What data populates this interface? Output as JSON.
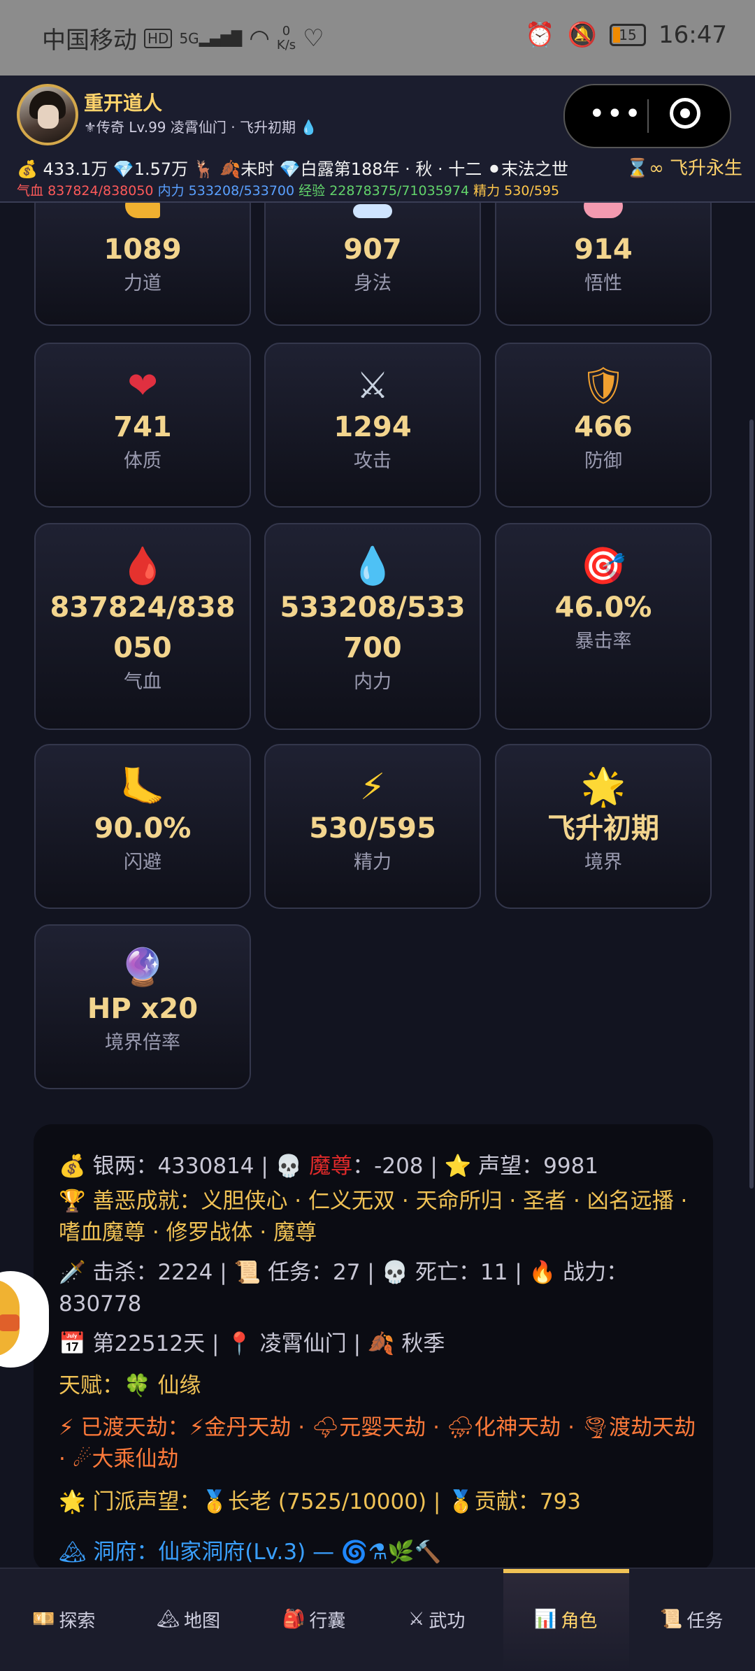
{
  "status_bar": {
    "carrier": "中国移动",
    "hd": "HD",
    "network": "5G",
    "speed_value": "0",
    "speed_unit": "K/s",
    "battery": "15",
    "time": "16:47"
  },
  "header": {
    "name": "重开道人",
    "subtitle": "⚜传奇 Lv.99 凌霄仙门 · 飞升初期 💧",
    "line1": "💰 433.1万 💎1.57万 🦌 🍂未时 💎白露第188年 · 秋 · 十二 ⚫末法之世",
    "ascend": "⌛∞ 飞升永生",
    "hp_label": "气血",
    "hp_value": "837824/838050",
    "mp_label": "内力",
    "mp_value": "533208/533700",
    "exp_label": "经验",
    "exp_value": "22878375/71035974",
    "en_label": "精力",
    "en_value": "530/595"
  },
  "stats": [
    {
      "value": "1089",
      "label": "力道",
      "icon": "muscle-icon"
    },
    {
      "value": "907",
      "label": "身法",
      "icon": "wind-icon"
    },
    {
      "value": "914",
      "label": "悟性",
      "icon": "brain-icon"
    },
    {
      "value": "741",
      "label": "体质",
      "glyph": "❤",
      "icon": "heart-icon"
    },
    {
      "value": "1294",
      "label": "攻击",
      "glyph": "⚔",
      "icon": "swords-icon"
    },
    {
      "value": "466",
      "label": "防御",
      "glyph": "🛡",
      "icon": "shield-icon"
    },
    {
      "value": "837824/838050",
      "label": "气血",
      "glyph": "🩸",
      "icon": "blood-drop-icon"
    },
    {
      "value": "533208/533700",
      "label": "内力",
      "glyph": "💧",
      "icon": "water-drop-icon"
    },
    {
      "value": "46.0%",
      "label": "暴击率",
      "glyph": "🎯",
      "icon": "target-icon"
    },
    {
      "value": "90.0%",
      "label": "闪避",
      "glyph": "🦶",
      "icon": "foot-icon"
    },
    {
      "value": "530/595",
      "label": "精力",
      "glyph": "⚡",
      "icon": "lightning-icon"
    },
    {
      "value": "飞升初期",
      "label": "境界",
      "glyph": "🌟",
      "icon": "star-icon"
    },
    {
      "value": "HP x20",
      "label": "境界倍率",
      "glyph": "🔮",
      "icon": "crystal-ball-icon"
    }
  ],
  "info": {
    "silver_label": "💰 银两：",
    "silver": "4330814",
    "demon_icon": "💀",
    "demon_label": "魔尊",
    "demon_value": "：-208",
    "fame_label": "⭐ 声望：",
    "fame": "9981",
    "achievements_label": "🏆 善恶成就：",
    "achievements": "义胆侠心 · 仁义无双 · 天命所归 · 圣者 · 凶名远播 · 嗜血魔尊 · 修罗战体 · 魔尊",
    "kills": "🗡️ 击杀：2224",
    "quests": "📜 任务：27",
    "deaths": "💀 死亡：11",
    "power": "🔥 战力：830778",
    "day": "📅 第22512天",
    "location": "📍 凌霄仙门",
    "season": "🍂 秋季",
    "talent_label": "天赋：",
    "talent": "🍀 仙缘",
    "tribulation_label": "⚡ 已渡天劫：",
    "tribulations": "⚡金丹天劫 · 🌩元婴天劫 · ⛈化神天劫 · 🌪渡劫天劫 · ☄大乘仙劫",
    "sect_label": "🌟 门派声望：",
    "sect": "🥇长老 (7525/10000)",
    "contribution": "🥇贡献：793",
    "cave_label": "🏔 洞府：",
    "cave": "仙家洞府(Lv.3)",
    "cave_extra": "— 🌀⚗🌿🔨",
    "sep": "|"
  },
  "nav": [
    {
      "glyph": "💴",
      "label": "探索",
      "icon": "explore-icon"
    },
    {
      "glyph": "🏔",
      "label": "地图",
      "icon": "map-icon"
    },
    {
      "glyph": "🎒",
      "label": "行囊",
      "icon": "bag-icon"
    },
    {
      "glyph": "⚔",
      "label": "武功",
      "icon": "martial-icon"
    },
    {
      "glyph": "📊",
      "label": "角色",
      "icon": "character-icon"
    },
    {
      "glyph": "📜",
      "label": "任务",
      "icon": "quest-icon"
    }
  ]
}
